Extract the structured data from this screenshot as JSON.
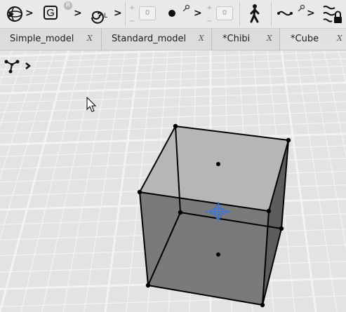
{
  "toolbar": {
    "items": [
      {
        "name": "viewport-sphere-tool",
        "icon": "sphere-icon"
      },
      {
        "name": "global-frame-tool",
        "icon": "frame-g-icon",
        "label": "G",
        "badge": "R"
      },
      {
        "name": "local-frame-tool",
        "icon": "spiral-l-icon",
        "label": "L"
      },
      {
        "name": "point-add-tool",
        "icon": "point-icon"
      },
      {
        "name": "walk-tool",
        "icon": "walking-person-icon"
      },
      {
        "name": "curve-tool",
        "icon": "curve-icon"
      },
      {
        "name": "edge-lock-tool",
        "icon": "edge-lock-icon"
      }
    ],
    "field_1": {
      "value": "0",
      "plus": "+",
      "minus": "−"
    },
    "field_2": {
      "value": "0",
      "plus": "+",
      "minus": "−"
    }
  },
  "tabs": [
    {
      "label": "Simple_model",
      "close": "X"
    },
    {
      "label": "Standard_model",
      "close": "X"
    },
    {
      "label": "*Chibi",
      "close": "X"
    },
    {
      "label": "*Cube",
      "close": "X",
      "active": true
    }
  ],
  "viewport": {
    "axes_widget": "axes-gizmo-icon",
    "object": "cube",
    "pivot": "transform-pivot-icon",
    "colors": {
      "background": "#e3e3e3",
      "grid": "#f3f3f3",
      "top_face": "#b6b6b6",
      "front_face": "#7a7a7a",
      "side_face": "#5d5d5d",
      "edge": "#000000",
      "pivot": "#3a76d4"
    }
  }
}
